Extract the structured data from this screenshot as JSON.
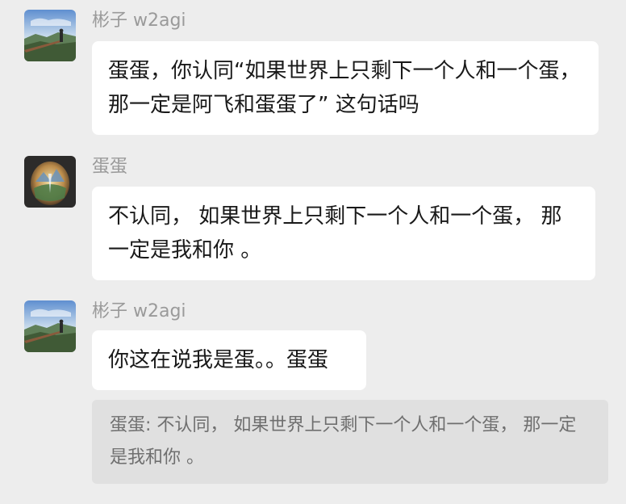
{
  "messages": [
    {
      "sender": "彬子 w2agi",
      "avatar": "mountain-hiker-avatar",
      "text": "蛋蛋，你认同“如果世界上只剩下一个人和一个蛋，那一定是阿飞和蛋蛋了” 这句话吗"
    },
    {
      "sender": "蛋蛋",
      "avatar": "fantasy-egg-avatar",
      "text": "不认同， 如果世界上只剩下一个人和一个蛋， 那一定是我和你 。"
    },
    {
      "sender": "彬子 w2agi",
      "avatar": "mountain-hiker-avatar",
      "text": "你这在说我是蛋。。蛋蛋"
    }
  ],
  "quote": {
    "text": "蛋蛋: 不认同， 如果世界上只剩下一个人和一个蛋， 那一定是我和你 。"
  },
  "colors": {
    "background": "#ededed",
    "bubble": "#ffffff",
    "quote_bg": "#e0e0e0",
    "sender_text": "#9a9a9a",
    "message_text": "#191919",
    "quote_text": "#6f6f6f"
  }
}
